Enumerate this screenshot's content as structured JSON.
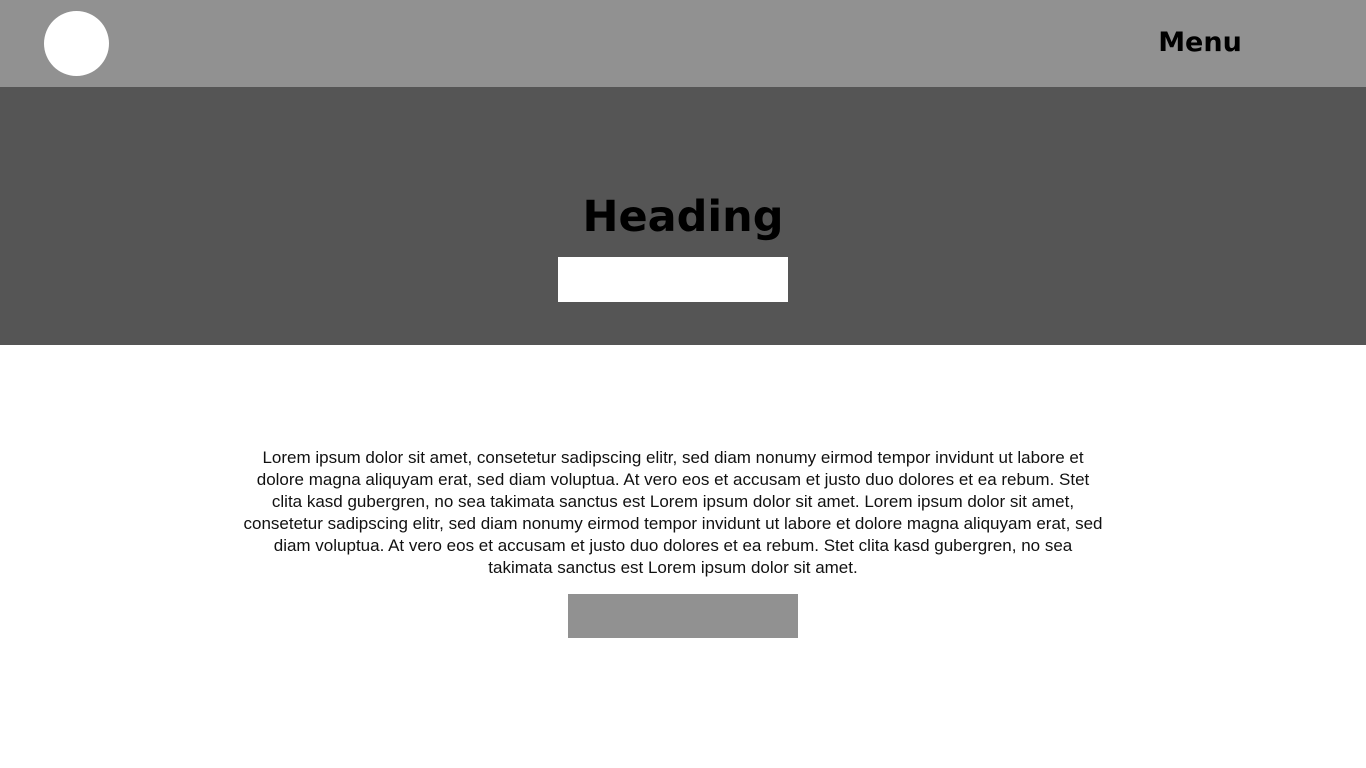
{
  "header": {
    "menu_label": "Menu"
  },
  "hero": {
    "heading": "Heading"
  },
  "content": {
    "paragraph": "Lorem ipsum dolor sit amet, consetetur sadipscing elitr, sed diam nonumy eirmod tempor invidunt ut labore et dolore magna aliquyam erat, sed diam voluptua. At vero eos et accusam et justo duo dolores et ea rebum. Stet clita kasd gubergren, no sea takimata sanctus est Lorem ipsum dolor sit amet. Lorem ipsum dolor sit amet, consetetur sadipscing elitr, sed diam nonumy eirmod tempor invidunt ut labore et dolore magna aliquyam erat, sed diam voluptua. At vero eos et accusam et justo duo dolores et ea rebum. Stet clita kasd gubergren, no sea takimata sanctus est Lorem ipsum dolor sit amet."
  },
  "colors": {
    "header_background": "#919191",
    "hero_background": "#555555",
    "page_background": "#ffffff",
    "logo_fill": "#ffffff",
    "hero_button_fill": "#ffffff",
    "content_button_fill": "#919191",
    "text": "#000000"
  },
  "icons": {
    "logo": "logo-circle-icon"
  }
}
